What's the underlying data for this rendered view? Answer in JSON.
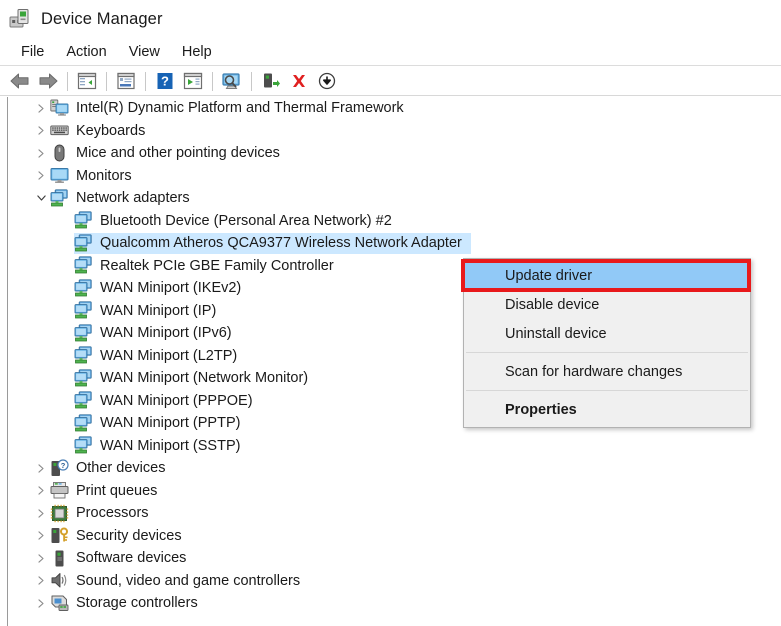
{
  "window": {
    "title": "Device Manager",
    "icon": "device-manager-icon"
  },
  "menubar": {
    "items": [
      {
        "label": "File",
        "name": "menu-file"
      },
      {
        "label": "Action",
        "name": "menu-action"
      },
      {
        "label": "View",
        "name": "menu-view"
      },
      {
        "label": "Help",
        "name": "menu-help"
      }
    ]
  },
  "toolbar": {
    "buttons": [
      {
        "icon": "back-arrow-icon",
        "label": "Back"
      },
      {
        "icon": "forward-arrow-icon",
        "label": "Forward"
      },
      {
        "icon": "show-hide-console-tree-icon",
        "label": "Show/Hide Console Tree"
      },
      {
        "icon": "properties-icon",
        "label": "Properties"
      },
      {
        "icon": "help-icon",
        "label": "Help"
      },
      {
        "icon": "update-driver-icon",
        "label": "Update Driver Software"
      },
      {
        "icon": "scan-hardware-changes-icon",
        "label": "Scan for hardware changes"
      },
      {
        "icon": "enable-device-icon",
        "label": "Enable device"
      },
      {
        "icon": "uninstall-device-icon",
        "label": "Uninstall device"
      },
      {
        "icon": "disable-device-icon",
        "label": "Disable device"
      }
    ]
  },
  "tree": {
    "rows": [
      {
        "label": "Intel(R) Dynamic Platform and Thermal Framework",
        "icon": "system-device-icon",
        "level": 0,
        "expander": "collapsed",
        "selected": false
      },
      {
        "label": "Keyboards",
        "icon": "keyboard-icon",
        "level": 0,
        "expander": "collapsed",
        "selected": false
      },
      {
        "label": "Mice and other pointing devices",
        "icon": "mouse-icon",
        "level": 0,
        "expander": "collapsed",
        "selected": false
      },
      {
        "label": "Monitors",
        "icon": "monitor-icon",
        "level": 0,
        "expander": "collapsed",
        "selected": false
      },
      {
        "label": "Network adapters",
        "icon": "network-adapter-icon",
        "level": 0,
        "expander": "expanded",
        "selected": false
      },
      {
        "label": "Bluetooth Device (Personal Area Network) #2",
        "icon": "network-adapter-icon",
        "level": 1,
        "expander": "none",
        "selected": false
      },
      {
        "label": "Qualcomm Atheros QCA9377 Wireless Network Adapter",
        "icon": "network-adapter-icon",
        "level": 1,
        "expander": "none",
        "selected": true
      },
      {
        "label": "Realtek PCIe GBE Family Controller",
        "icon": "network-adapter-icon",
        "level": 1,
        "expander": "none",
        "selected": false
      },
      {
        "label": "WAN Miniport (IKEv2)",
        "icon": "network-adapter-icon",
        "level": 1,
        "expander": "none",
        "selected": false
      },
      {
        "label": "WAN Miniport (IP)",
        "icon": "network-adapter-icon",
        "level": 1,
        "expander": "none",
        "selected": false
      },
      {
        "label": "WAN Miniport (IPv6)",
        "icon": "network-adapter-icon",
        "level": 1,
        "expander": "none",
        "selected": false
      },
      {
        "label": "WAN Miniport (L2TP)",
        "icon": "network-adapter-icon",
        "level": 1,
        "expander": "none",
        "selected": false
      },
      {
        "label": "WAN Miniport (Network Monitor)",
        "icon": "network-adapter-icon",
        "level": 1,
        "expander": "none",
        "selected": false
      },
      {
        "label": "WAN Miniport (PPPOE)",
        "icon": "network-adapter-icon",
        "level": 1,
        "expander": "none",
        "selected": false
      },
      {
        "label": "WAN Miniport (PPTP)",
        "icon": "network-adapter-icon",
        "level": 1,
        "expander": "none",
        "selected": false
      },
      {
        "label": "WAN Miniport (SSTP)",
        "icon": "network-adapter-icon",
        "level": 1,
        "expander": "none",
        "selected": false
      },
      {
        "label": "Other devices",
        "icon": "unknown-device-icon",
        "level": 0,
        "expander": "collapsed",
        "selected": false
      },
      {
        "label": "Print queues",
        "icon": "printer-icon",
        "level": 0,
        "expander": "collapsed",
        "selected": false
      },
      {
        "label": "Processors",
        "icon": "processor-icon",
        "level": 0,
        "expander": "collapsed",
        "selected": false
      },
      {
        "label": "Security devices",
        "icon": "security-device-icon",
        "level": 0,
        "expander": "collapsed",
        "selected": false
      },
      {
        "label": "Software devices",
        "icon": "software-device-icon",
        "level": 0,
        "expander": "collapsed",
        "selected": false
      },
      {
        "label": "Sound, video and game controllers",
        "icon": "speaker-icon",
        "level": 0,
        "expander": "collapsed",
        "selected": false
      },
      {
        "label": "Storage controllers",
        "icon": "storage-controller-icon",
        "level": 0,
        "expander": "collapsed",
        "selected": false
      }
    ]
  },
  "context_menu": {
    "items": [
      {
        "label": "Update driver",
        "highlighted": true,
        "bold": false,
        "separator_after": false
      },
      {
        "label": "Disable device",
        "highlighted": false,
        "bold": false,
        "separator_after": false
      },
      {
        "label": "Uninstall device",
        "highlighted": false,
        "bold": false,
        "separator_after": true
      },
      {
        "label": "Scan for hardware changes",
        "highlighted": false,
        "bold": false,
        "separator_after": true
      },
      {
        "label": "Properties",
        "highlighted": false,
        "bold": true,
        "separator_after": false
      }
    ]
  },
  "annotation": {
    "highlight_color": "#e8191b",
    "target": "Update driver"
  },
  "colors": {
    "selection": "#cce8ff",
    "menu_highlight": "#91c9f7",
    "menu_background": "#f0f0f0",
    "annotation_red": "#e8191b"
  }
}
